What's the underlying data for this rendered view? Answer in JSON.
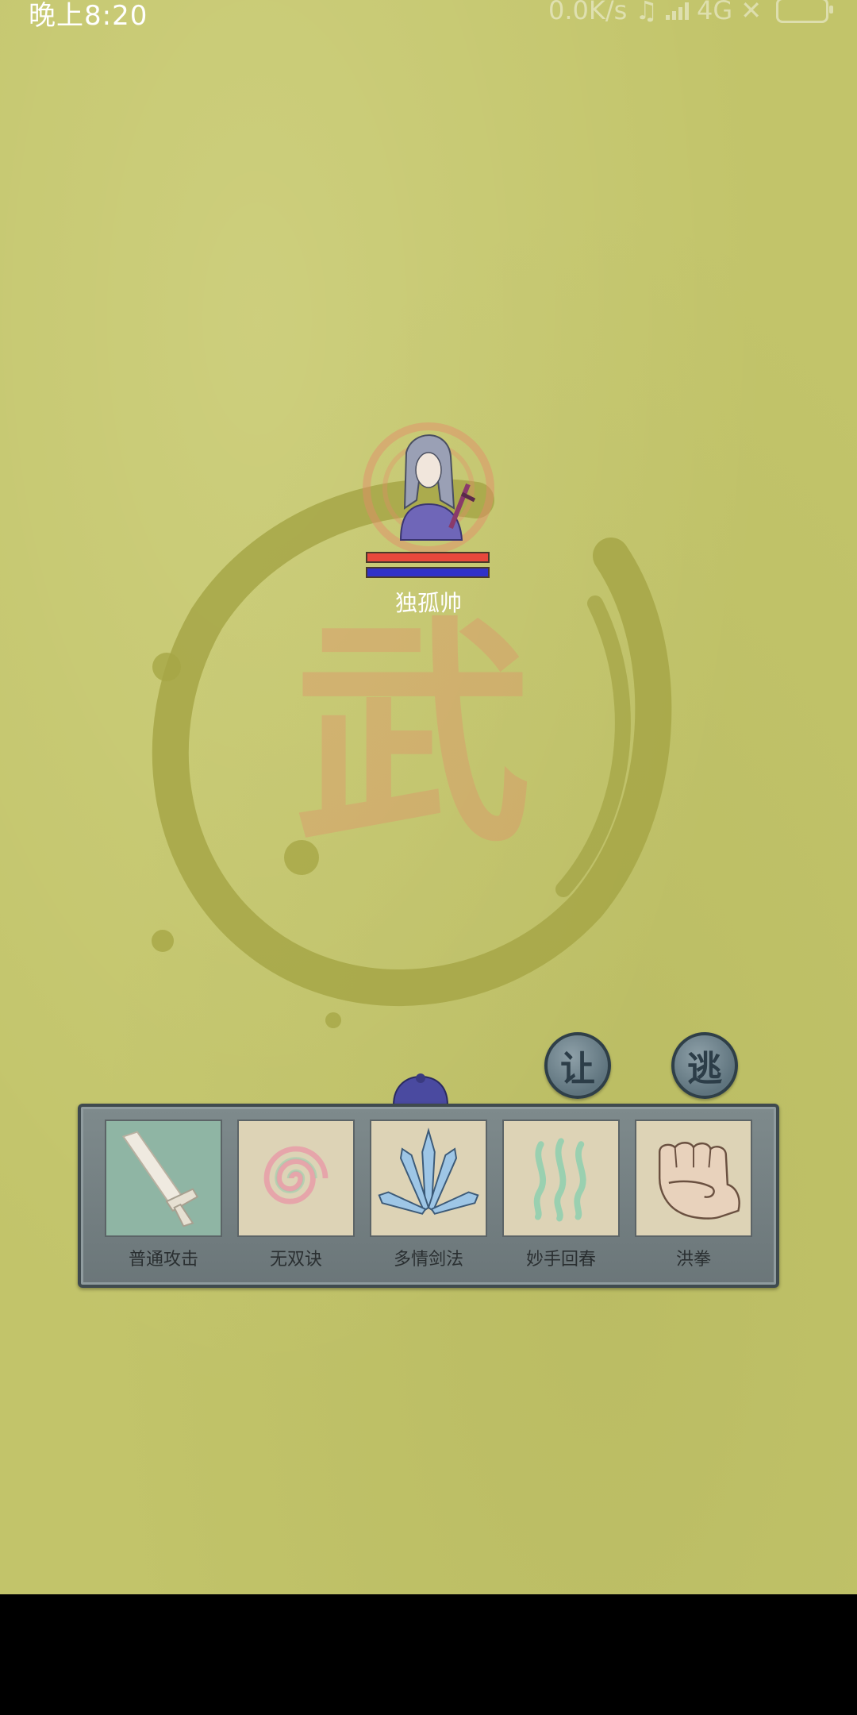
{
  "status_bar": {
    "time": "晚上8:20",
    "network_speed": "0.0K/s",
    "network_type": "4G"
  },
  "battle": {
    "background_character": "武",
    "enemy": {
      "name": "独孤帅",
      "hp_fraction": 1.0,
      "mp_fraction": 1.0
    },
    "buttons": {
      "yield_label": "让",
      "flee_label": "逃"
    }
  },
  "skills": [
    {
      "label": "普通攻击",
      "icon": "sword-icon"
    },
    {
      "label": "无双诀",
      "icon": "spiral-icon"
    },
    {
      "label": "多情剑法",
      "icon": "swords-fan-icon"
    },
    {
      "label": "妙手回春",
      "icon": "healing-waves-icon"
    },
    {
      "label": "洪拳",
      "icon": "fist-icon"
    }
  ],
  "colors": {
    "background": "#c2c46a",
    "hp": "#e8483c",
    "mp": "#3131c8",
    "panel": "#727d80"
  }
}
